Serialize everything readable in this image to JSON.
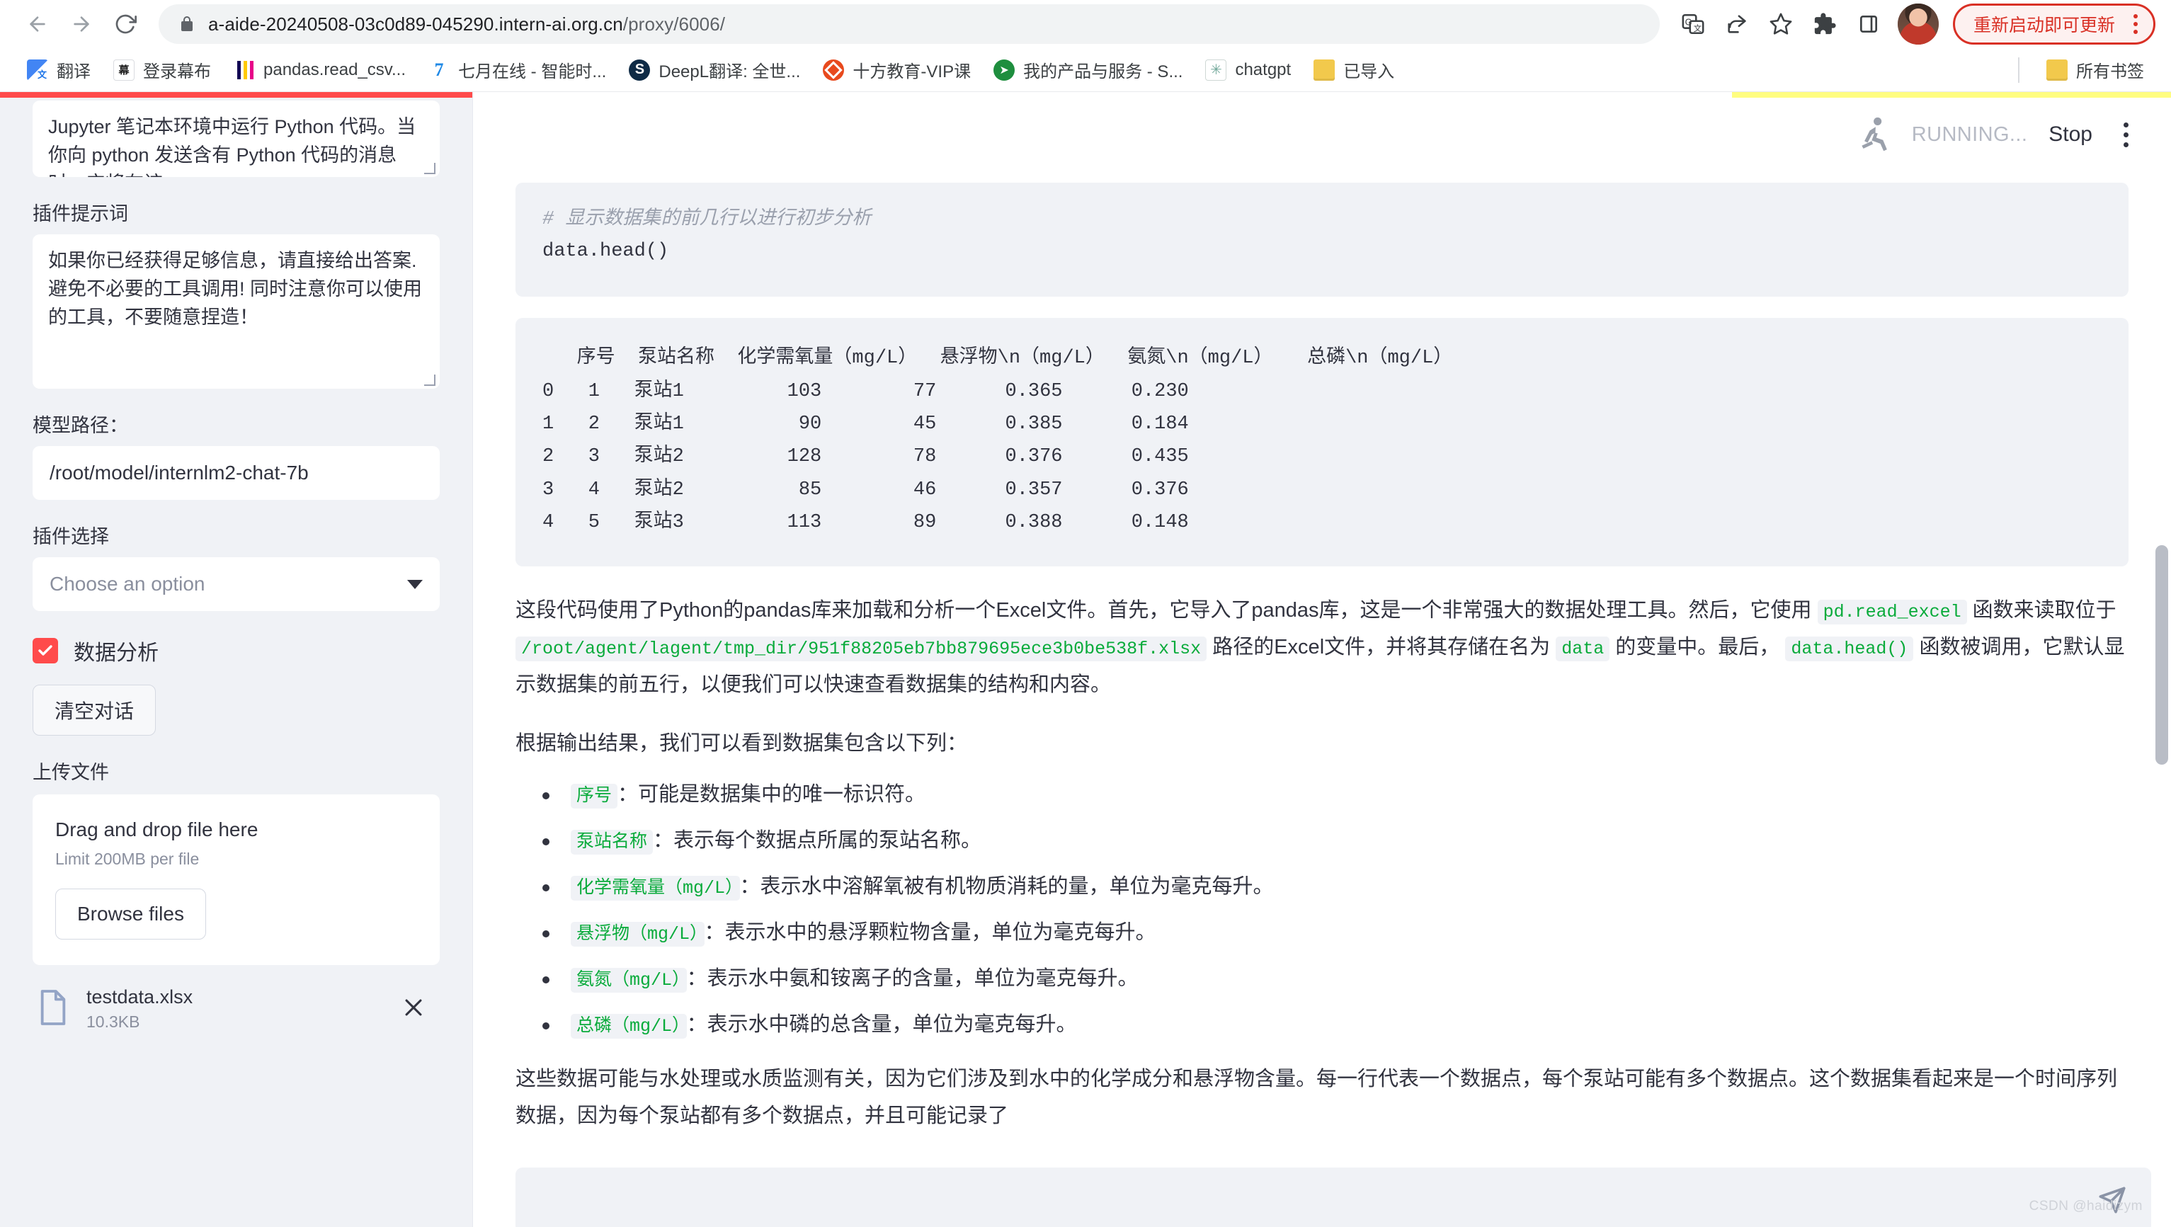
{
  "browser": {
    "url_main": "a-aide-20240508-03c0d89-045290.intern-ai.org.cn",
    "url_path": "/proxy/6006/",
    "back_icon": "back-arrow-icon",
    "forward_icon": "forward-arrow-icon",
    "reload_icon": "reload-icon",
    "lock_icon": "lock-icon",
    "translate_icon": "translate-icon",
    "share_icon": "share-icon",
    "bookmark_star_icon": "star-icon",
    "extensions_icon": "puzzle-piece-icon",
    "sidepanel_icon": "side-panel-icon",
    "avatar_icon": "profile-avatar",
    "update_label": "重新启动即可更新",
    "menu_icon": "three-dot-menu-icon"
  },
  "bookmarks": {
    "items": [
      {
        "label": "翻译",
        "icon": "google-translate-icon"
      },
      {
        "label": "登录幕布",
        "icon": "mubu-icon"
      },
      {
        "label": "pandas.read_csv...",
        "icon": "pandas-icon"
      },
      {
        "label": "七月在线 - 智能时...",
        "icon": "julyedu-icon"
      },
      {
        "label": "DeepL翻译: 全世...",
        "icon": "deepl-icon"
      },
      {
        "label": "十方教育-VIP课",
        "icon": "shifang-icon"
      },
      {
        "label": "我的产品与服务 - S...",
        "icon": "myproducts-icon"
      },
      {
        "label": "chatgpt",
        "icon": "chatgpt-icon"
      },
      {
        "label": "已导入",
        "icon": "folder-icon"
      }
    ],
    "all_bookmarks": "所有书签",
    "all_bookmarks_icon": "folder-icon"
  },
  "sidebar": {
    "system_prompt_textarea": {
      "value": "Jupyter 笔记本环境中运行 Python 代码。当你向 python 发送含有 Python 代码的消息时，它将在该"
    },
    "plugin_prompt_label": "插件提示词",
    "plugin_prompt_textarea": {
      "value": "如果你已经获得足够信息，请直接给出答案. 避免不必要的工具调用! 同时注意你可以使用的工具，不要随意捏造！"
    },
    "model_path_label": "模型路径：",
    "model_path_value": "/root/model/internlm2-chat-7b",
    "plugin_select_label": "插件选择",
    "plugin_select_value": "Choose an option",
    "chevron_icon": "chevron-down-icon",
    "checkbox_label": "数据分析",
    "checkbox_checked": true,
    "check_icon": "check-icon",
    "clear_chat_button": "清空对话",
    "upload_label": "上传文件",
    "dropzone_title": "Drag and drop file here",
    "dropzone_limit": "Limit 200MB per file",
    "browse_button": "Browse files",
    "uploaded_file": {
      "name": "testdata.xlsx",
      "size": "10.3KB",
      "icon": "document-icon",
      "remove_icon": "close-icon"
    }
  },
  "main": {
    "status_icon": "running-person-icon",
    "status_text": "RUNNING...",
    "stop_button": "Stop",
    "menu_icon": "three-dot-menu-icon",
    "code_comment": "# 显示数据集的前几行以进行初步分析",
    "code_line": "data.head()",
    "output_table": "   序号  泵站名称  化学需氧量（mg/L）  悬浮物\\n（mg/L）  氨氮\\n（mg/L）   总磷\\n（mg/L）\n0   1   泵站1         103        77      0.365      0.230\n1   2   泵站1          90        45      0.385      0.184\n2   3   泵站2         128        78      0.376      0.435\n3   4   泵站2          85        46      0.357      0.376\n4   5   泵站3         113        89      0.388      0.148",
    "para1_a": "这段代码使用了Python的pandas库来加载和分析一个Excel文件。首先，它导入了pandas库，这是一个非常强大的数据处理工具。然后，它使用",
    "para1_code1": "pd.read_excel",
    "para1_b": "函数来读取位于",
    "para1_path": "/root/agent/lagent/tmp_dir/951f88205eb7bb879695ece3b0be538f.xlsx",
    "para1_c": "路径的Excel文件，并将其存储在名为",
    "para1_code2": "data",
    "para1_d": "的变量中。最后，",
    "para1_code3": "data.head()",
    "para1_e": "函数被调用，它默认显示数据集的前五行，以便我们可以快速查看数据集的结构和内容。",
    "para2": "根据输出结果，我们可以看到数据集包含以下列：",
    "bullets": [
      {
        "code": "序号",
        "text": "：可能是数据集中的唯一标识符。"
      },
      {
        "code": "泵站名称",
        "text": "：表示每个数据点所属的泵站名称。"
      },
      {
        "code": "化学需氧量（mg/L）",
        "text": "：表示水中溶解氧被有机物质消耗的量，单位为毫克每升。"
      },
      {
        "code": "悬浮物（mg/L）",
        "text": "：表示水中的悬浮颗粒物含量，单位为毫克每升。"
      },
      {
        "code": "氨氮（mg/L）",
        "text": "：表示水中氨和铵离子的含量，单位为毫克每升。"
      },
      {
        "code": "总磷（mg/L）",
        "text": "：表示水中磷的总含量，单位为毫克每升。"
      }
    ],
    "para3": "这些数据可能与水处理或水质监测有关，因为它们涉及到水中的化学成分和悬浮物含量。每一行代表一个数据点，每个泵站可能有多个数据点。这个数据集看起来是一个时间序列数据，因为每个泵站都有多个数据点，并且可能记录了",
    "chat_input_placeholder": "",
    "send_icon": "send-icon",
    "watermark": "CSDN @haidizym"
  },
  "chart_data": {
    "type": "table",
    "title": "data.head()",
    "columns": [
      "序号",
      "泵站名称",
      "化学需氧量（mg/L）",
      "悬浮物\\n（mg/L）",
      "氨氮\\n（mg/L）",
      "总磷\\n（mg/L）"
    ],
    "index": [
      0,
      1,
      2,
      3,
      4
    ],
    "rows": [
      [
        1,
        "泵站1",
        103,
        77,
        0.365,
        0.23
      ],
      [
        2,
        "泵站1",
        90,
        45,
        0.385,
        0.184
      ],
      [
        3,
        "泵站2",
        128,
        78,
        0.376,
        0.435
      ],
      [
        4,
        "泵站2",
        85,
        46,
        0.357,
        0.376
      ],
      [
        5,
        "泵站3",
        113,
        89,
        0.388,
        0.148
      ]
    ]
  },
  "colors": {
    "accent_red": "#ff4b4b",
    "code_green": "#09ab3b",
    "panel_bg": "#f0f2f6",
    "update_red": "#d93025",
    "status_yellow": "#fffd80"
  }
}
